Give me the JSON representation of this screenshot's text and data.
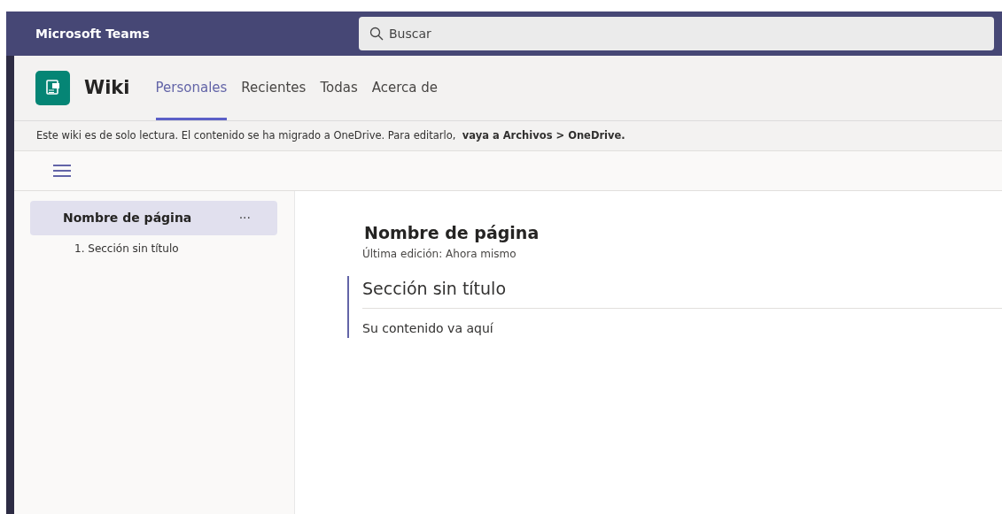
{
  "app_bar": {
    "title": "Microsoft Teams",
    "search": {
      "placeholder": "Buscar"
    }
  },
  "app_header": {
    "name": "Wiki",
    "tabs": [
      {
        "label": "Personales",
        "selected": true
      },
      {
        "label": "Recientes",
        "selected": false
      },
      {
        "label": "Todas",
        "selected": false
      },
      {
        "label": "Acerca de",
        "selected": false
      }
    ]
  },
  "banner": "Este wiki es de solo lectura. El contenido se ha migrado a OneDrive. Para editarlo,  **vaya a Archivos > OneDrive.**",
  "sidebar": {
    "items": [
      {
        "label": "Nombre de página",
        "more": "···",
        "selected": true,
        "children": [
          {
            "label": "1. Sección sin título",
            "selected": false
          }
        ]
      }
    ]
  },
  "page": {
    "title": "Nombre de página",
    "edited": "Última edición: Ahora mismo",
    "sections": [
      {
        "title": "Sección sin título",
        "body": "Su contenido va aquí"
      }
    ]
  }
}
